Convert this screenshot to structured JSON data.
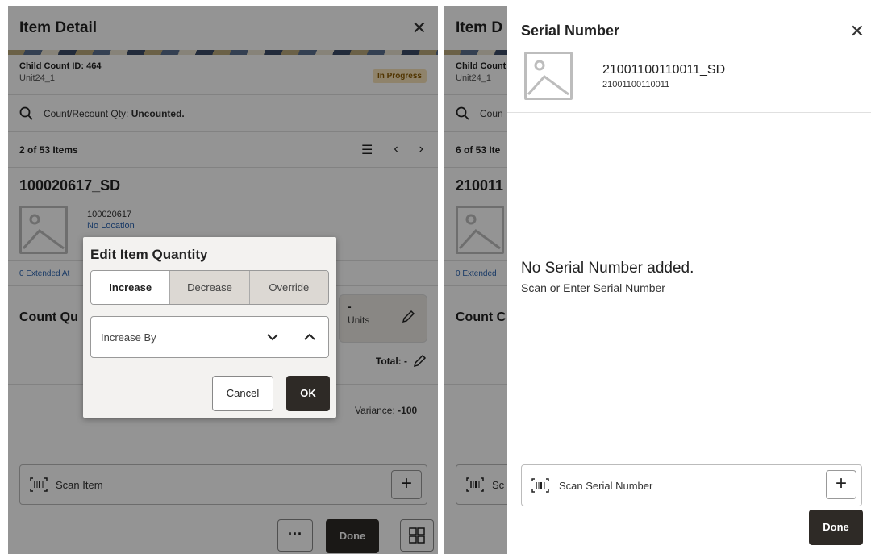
{
  "left": {
    "header_title": "Item Detail",
    "child_count_id": "Child Count ID: 464",
    "unit": "Unit24_1",
    "status_badge": "In Progress",
    "search_label": "Count/Recount Qty:",
    "search_value": "Uncounted.",
    "items_position": "2 of 53 Items",
    "item_title": "100020617_SD",
    "item_number": "100020617",
    "item_location": "No Location",
    "extended_attributes": "0 Extended At",
    "count_title": "Count Qu",
    "units_dash": "-",
    "units_label": "Units",
    "total_label": "Total: -",
    "variance_label": "Variance:",
    "variance_value": "-100",
    "scan_placeholder": "Scan Item",
    "plus_label": "+",
    "dots_label": "···",
    "done_label": "Done",
    "dialog": {
      "title": "Edit Item Quantity",
      "segments": [
        "Increase",
        "Decrease",
        "Override"
      ],
      "select_value": "Increase By",
      "cancel_label": "Cancel",
      "ok_label": "OK"
    }
  },
  "right": {
    "header_title": "Item D",
    "child_count_id": "Child Count",
    "unit": "Unit24_1",
    "search_label": "Coun",
    "items_position": "6 of 53 Ite",
    "item_title": "210011",
    "extended_attributes": "0 Extended",
    "count_title": "Count C",
    "scan_label": "Sc",
    "drawer": {
      "title": "Serial Number",
      "item_name": "21001100110011_SD",
      "item_number": "21001100110011",
      "empty_title": "No Serial Number added.",
      "empty_subtitle": "Scan or Enter Serial Number",
      "scan_placeholder": "Scan Serial Number",
      "plus_label": "+",
      "done_label": "Done"
    }
  }
}
